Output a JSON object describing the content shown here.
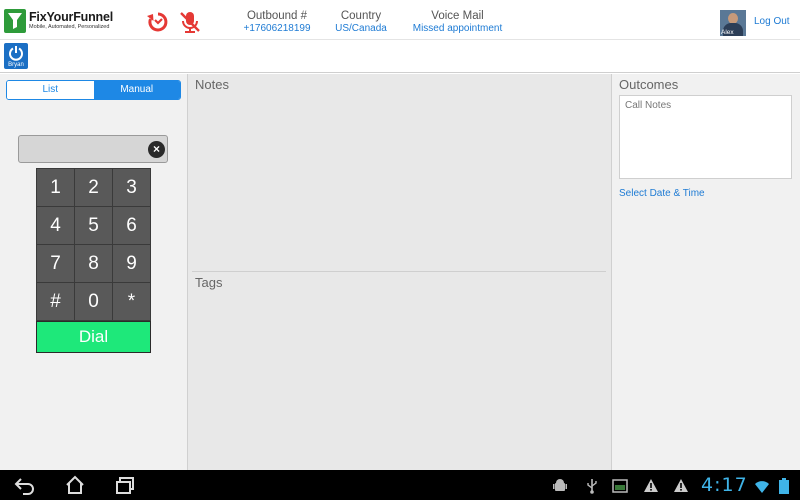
{
  "header": {
    "brand": "FixYourFunnel",
    "tagline": "Mobile, Automated, Personalized",
    "outbound_label": "Outbound #",
    "outbound_value": "+17606218199",
    "country_label": "Country",
    "country_value": "US/Canada",
    "voicemail_label": "Voice Mail",
    "voicemail_value": "Missed appointment",
    "user_name": "Alex",
    "logout_label": "Log Out",
    "icons": [
      "redial-icon",
      "mute-microphone-icon"
    ]
  },
  "subbar": {
    "agent_name": "Bryan"
  },
  "dialer": {
    "tabs": [
      "List",
      "Manual"
    ],
    "active_tab": "Manual",
    "number_value": "",
    "keys": [
      "1",
      "2",
      "3",
      "4",
      "5",
      "6",
      "7",
      "8",
      "9",
      "#",
      "0",
      "*"
    ],
    "dial_label": "Dial"
  },
  "main": {
    "notes_title": "Notes",
    "tags_title": "Tags"
  },
  "outcomes": {
    "title": "Outcomes",
    "call_notes_placeholder": "Call Notes",
    "select_date_label": "Select Date & Time"
  },
  "statusbar": {
    "time": "4:17"
  },
  "colors": {
    "accent": "#1e88e5",
    "link": "#1e7bd4",
    "dial": "#1ee87a",
    "alert_red": "#e53935",
    "clock": "#3fb4e8"
  }
}
